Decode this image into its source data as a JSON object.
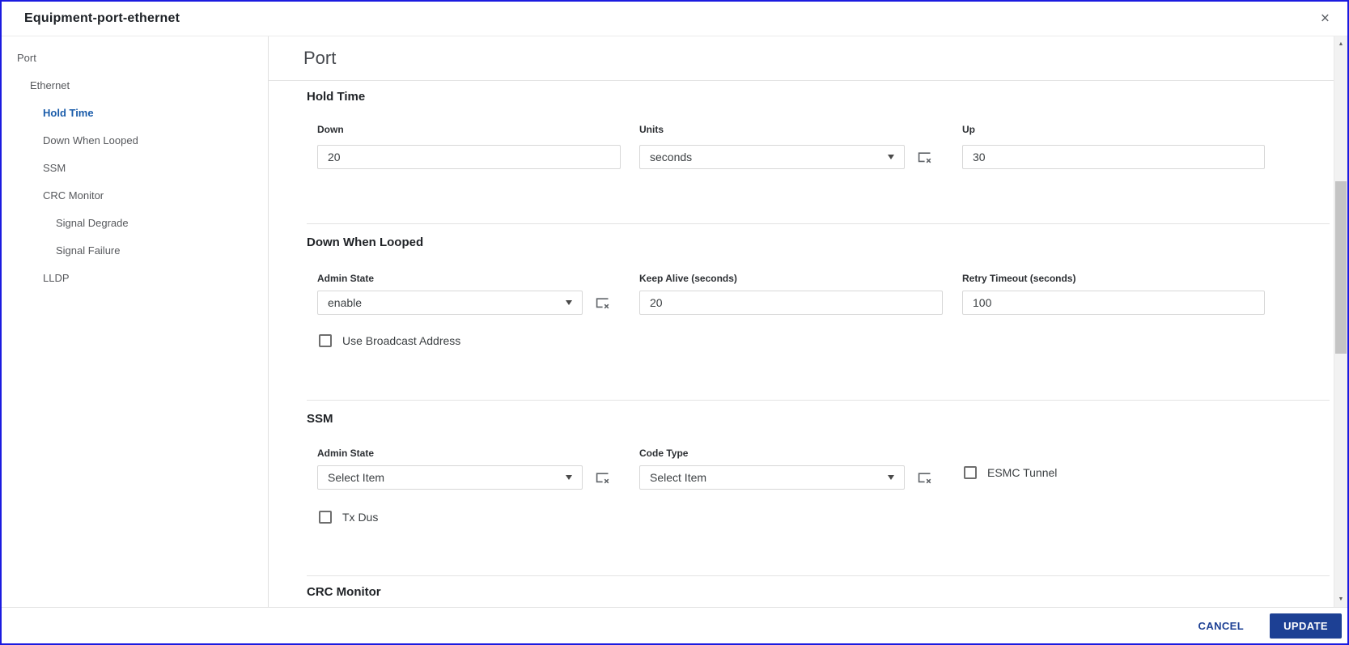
{
  "window": {
    "title": "Equipment-port-ethernet",
    "close_glyph": "×"
  },
  "sidebar": {
    "items": [
      {
        "label": "Port",
        "level": 0,
        "selected": false
      },
      {
        "label": "Ethernet",
        "level": 1,
        "selected": false
      },
      {
        "label": "Hold Time",
        "level": 2,
        "selected": true
      },
      {
        "label": "Down When Looped",
        "level": 2,
        "selected": false
      },
      {
        "label": "SSM",
        "level": 2,
        "selected": false
      },
      {
        "label": "CRC Monitor",
        "level": 2,
        "selected": false
      },
      {
        "label": "Signal Degrade",
        "level": 3,
        "selected": false
      },
      {
        "label": "Signal Failure",
        "level": 3,
        "selected": false
      },
      {
        "label": "LLDP",
        "level": 2,
        "selected": false
      }
    ]
  },
  "content": {
    "page_title": "Port",
    "sections": {
      "hold_time": {
        "title": "Hold Time",
        "down_label": "Down",
        "down_value": "20",
        "units_label": "Units",
        "units_value": "seconds",
        "up_label": "Up",
        "up_value": "30"
      },
      "down_when_looped": {
        "title": "Down When Looped",
        "admin_state_label": "Admin State",
        "admin_state_value": "enable",
        "keep_alive_label": "Keep Alive (seconds)",
        "keep_alive_value": "20",
        "retry_timeout_label": "Retry Timeout (seconds)",
        "retry_timeout_value": "100",
        "use_broadcast_label": "Use Broadcast Address",
        "use_broadcast_checked": false
      },
      "ssm": {
        "title": "SSM",
        "admin_state_label": "Admin State",
        "admin_state_value": "Select Item",
        "code_type_label": "Code Type",
        "code_type_value": "Select Item",
        "esmc_tunnel_label": "ESMC Tunnel",
        "esmc_tunnel_checked": false,
        "tx_dus_label": "Tx Dus",
        "tx_dus_checked": false
      },
      "crc_monitor": {
        "title": "CRC Monitor"
      }
    }
  },
  "footer": {
    "cancel_label": "CANCEL",
    "update_label": "UPDATE"
  },
  "scrollbar": {
    "up_glyph": "▲",
    "down_glyph": "▼"
  },
  "icons": {
    "close": "close-icon",
    "clear_selection": "clear-selection-icon",
    "dropdown_caret": "chevron-down-icon"
  },
  "colors": {
    "window_border": "#1b1be0",
    "selected_nav_blue": "#1a5caa",
    "primary_button_navy": "#1d4094",
    "divider_gray": "#e3e3e3"
  }
}
